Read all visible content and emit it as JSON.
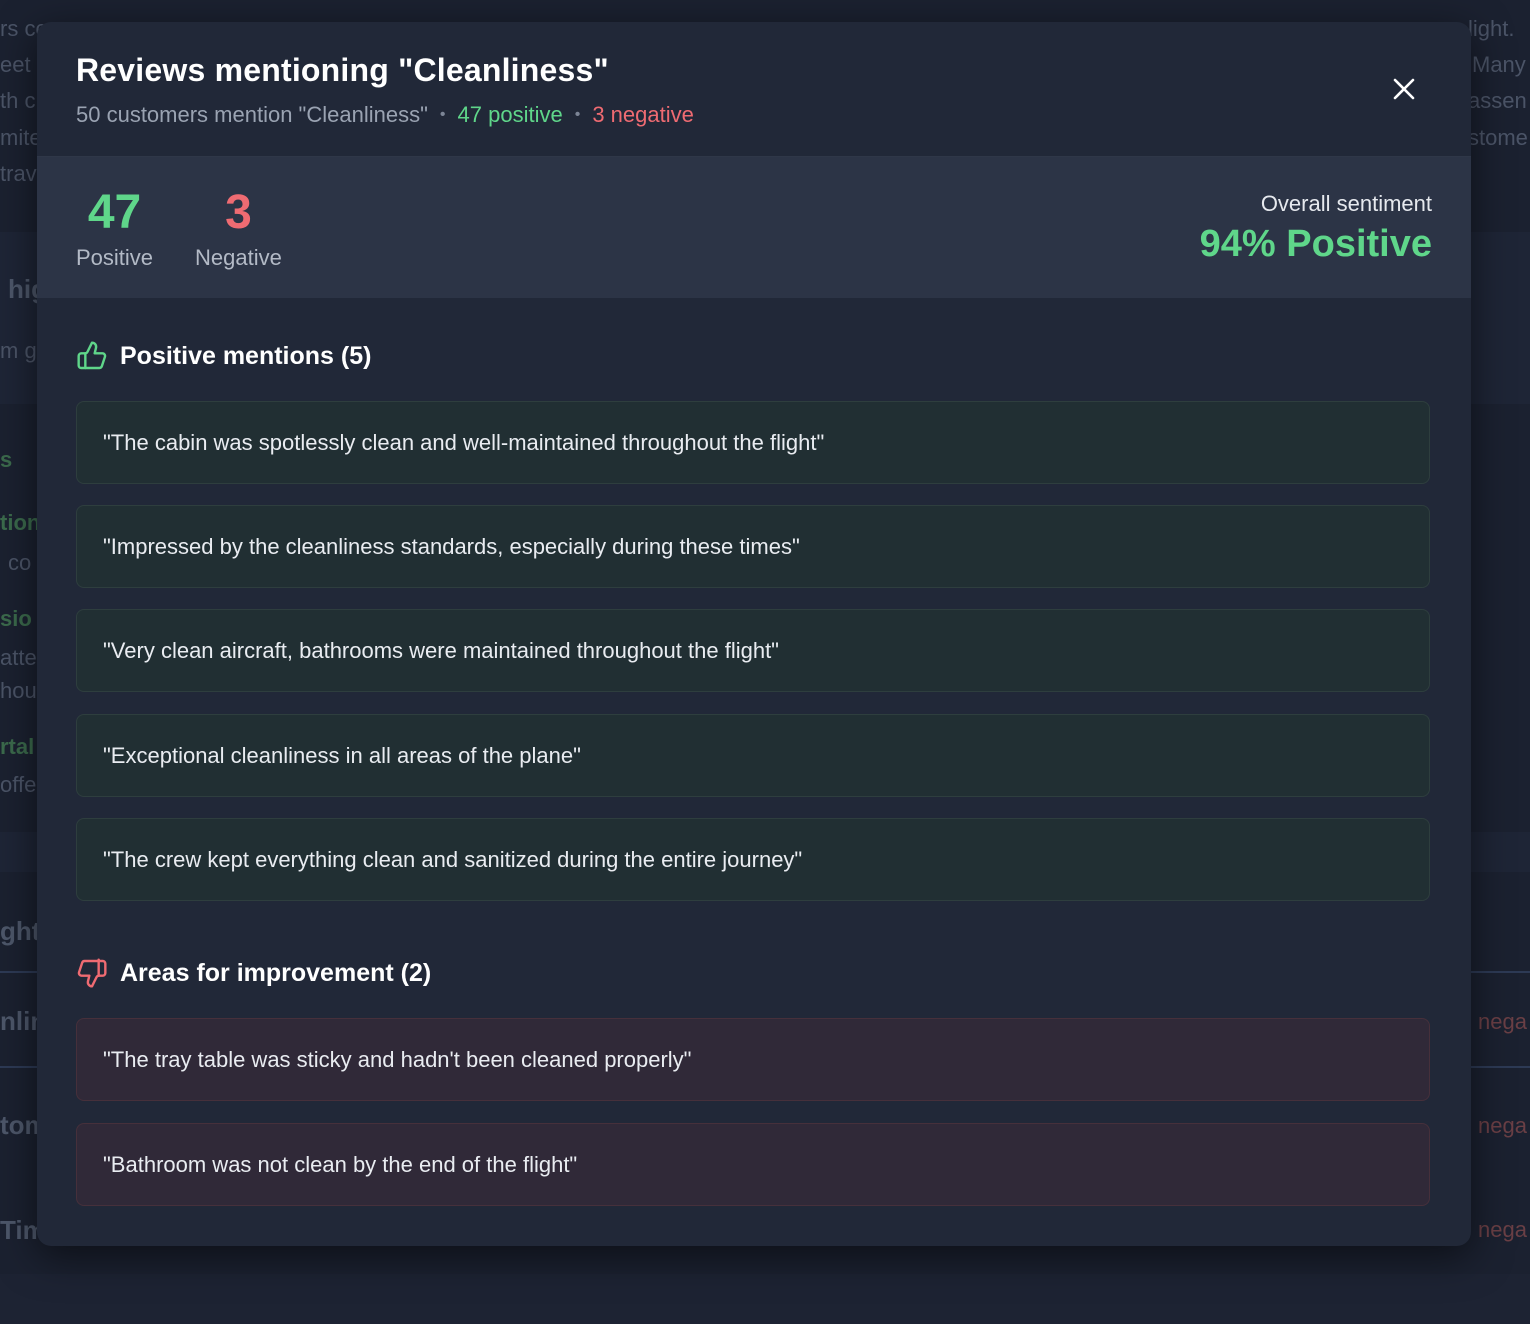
{
  "background": {
    "fragments": [
      "rs co",
      "eet",
      "th cl",
      "mite",
      "trav",
      "hig",
      "m g",
      "s",
      "tion",
      "co",
      "sio",
      "atte",
      "hou",
      "rtal",
      "offe",
      "ghts",
      "nlin",
      "tom",
      "Tim",
      "light.",
      "Many",
      "assen",
      "stome",
      "nega",
      "nega",
      "nega"
    ]
  },
  "modal": {
    "title": "Reviews mentioning \"Cleanliness\"",
    "subtitle": {
      "summary": "50 customers mention \"Cleanliness\"",
      "separator": "•",
      "positive": "47 positive",
      "negative": "3 negative"
    },
    "close_icon": "close-icon",
    "stats": {
      "positive": {
        "value": "47",
        "label": "Positive"
      },
      "negative": {
        "value": "3",
        "label": "Negative"
      },
      "overall_label": "Overall sentiment",
      "overall_value": "94% Positive"
    },
    "positive_section": {
      "icon": "thumbs-up-icon",
      "title": "Positive mentions (5)",
      "items": [
        "\"The cabin was spotlessly clean and well-maintained throughout the flight\"",
        "\"Impressed by the cleanliness standards, especially during these times\"",
        "\"Very clean aircraft, bathrooms were maintained throughout the flight\"",
        "\"Exceptional cleanliness in all areas of the plane\"",
        "\"The crew kept everything clean and sanitized during the entire journey\""
      ]
    },
    "negative_section": {
      "icon": "thumbs-down-icon",
      "title": "Areas for improvement (2)",
      "items": [
        "\"The tray table was sticky and hadn't been cleaned properly\"",
        "\"Bathroom was not clean by the end of the flight\""
      ]
    },
    "colors": {
      "positive": "#5fd68a",
      "negative": "#ef6b72",
      "modal_bg": "#212838",
      "stats_bg": "#2c3446"
    }
  }
}
